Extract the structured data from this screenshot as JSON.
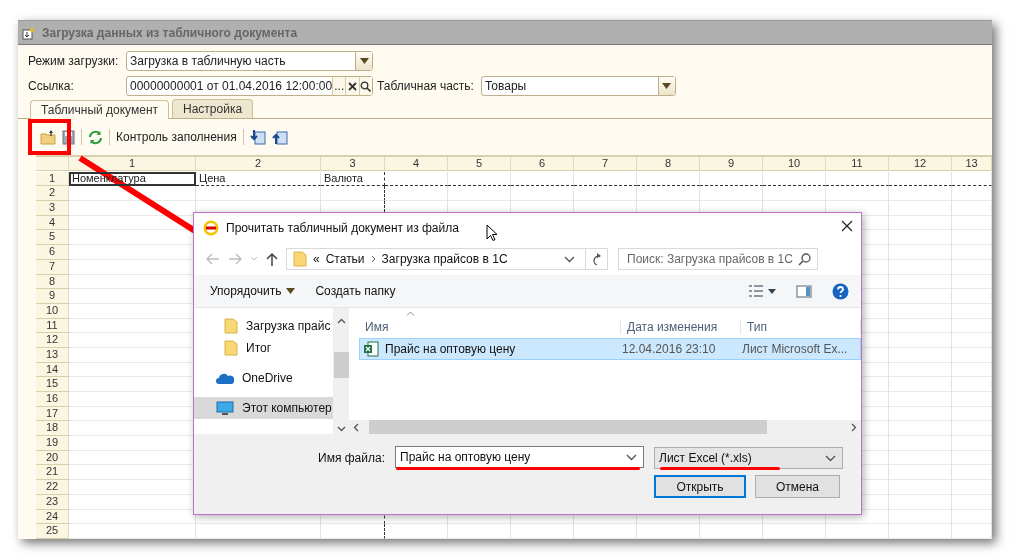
{
  "window": {
    "title": "Загрузка данных из табличного документа"
  },
  "form": {
    "mode": {
      "label": "Режим загрузки:",
      "value": "Загрузка в табличную часть"
    },
    "link": {
      "label": "Ссылка:",
      "value": "00000000001 от 01.04.2016 12:00:00",
      "select_button": "..."
    },
    "table_part": {
      "label": "Табличная часть:",
      "value": "Товары"
    }
  },
  "tabs": [
    {
      "label": "Табличный документ",
      "selected": true
    },
    {
      "label": "Настройка",
      "selected": false
    }
  ],
  "toolbar": {
    "fill_check": "Контроль заполнения"
  },
  "sheet": {
    "columns": [
      "1",
      "2",
      "3",
      "4",
      "5",
      "6",
      "7",
      "8",
      "9",
      "10",
      "11",
      "12",
      "13"
    ],
    "rows": [
      "1",
      "2",
      "3",
      "4",
      "5",
      "6",
      "7",
      "8",
      "9",
      "10",
      "11",
      "12",
      "13",
      "14",
      "15",
      "16",
      "17",
      "18",
      "19",
      "20",
      "21",
      "22",
      "23",
      "24",
      "25"
    ],
    "cells": [
      {
        "text": "Номенклатура",
        "selected": true
      },
      {
        "text": "Цена",
        "selected": false
      },
      {
        "text": "Валюта",
        "selected": false
      }
    ]
  },
  "dialog": {
    "title": "Прочитать табличный документ из файла",
    "path_prefix": "«",
    "path": [
      "Статьи",
      "Загрузка прайсов в 1С"
    ],
    "search": {
      "placeholder": "Поиск: Загрузка прайсов в 1С"
    },
    "toolbar": {
      "organize": "Упорядочить",
      "new_folder": "Создать папку"
    },
    "nav": [
      {
        "label": "Загрузка прайс",
        "kind": "folder",
        "selected": false
      },
      {
        "label": "Итог",
        "kind": "folder",
        "selected": false
      },
      {
        "label": "OneDrive",
        "kind": "cloud",
        "selected": false
      },
      {
        "label": "Этот компьютер",
        "kind": "computer",
        "selected": true
      }
    ],
    "columns": [
      "Имя",
      "Дата изменения",
      "Тип"
    ],
    "files": [
      {
        "name": "Прайс на оптовую цену",
        "date": "12.04.2016 23:10",
        "type": "Лист Microsoft Ex...",
        "selected": true
      }
    ],
    "file_name": {
      "label": "Имя файла:",
      "value": "Прайс на оптовую цену"
    },
    "filter": "Лист Excel (*.xls)",
    "buttons": [
      {
        "label": "Открыть",
        "default": true
      },
      {
        "label": "Отмена",
        "default": false
      }
    ]
  }
}
